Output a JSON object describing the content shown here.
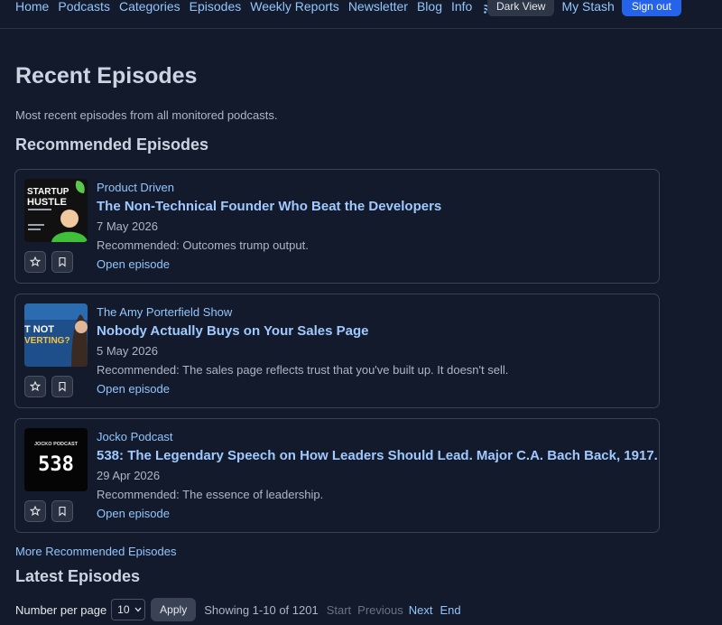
{
  "nav": {
    "items": [
      "Home",
      "Podcasts",
      "Categories",
      "Episodes",
      "Weekly Reports",
      "Newsletter",
      "Blog",
      "Info"
    ],
    "dark_view": "Dark View",
    "my_stash": "My Stash",
    "sign_out": "Sign out"
  },
  "page": {
    "title": "Recent Episodes",
    "subtitle": "Most recent episodes from all monitored podcasts.",
    "recommended_heading": "Recommended Episodes",
    "latest_heading": "Latest Episodes",
    "more_recommended": "More Recommended Episodes"
  },
  "recommended": [
    {
      "podcast": "Product Driven",
      "title": "The Non-Technical Founder Who Beat the Developers",
      "date": "7 May 2026",
      "recommendation": "Recommended: Outcomes trump output.",
      "open": "Open episode",
      "thumb_text": [
        "STARTUP",
        "HUSTLE"
      ]
    },
    {
      "podcast": "The Amy Porterfield Show",
      "title": "Nobody Actually Buys on Your Sales Page",
      "date": "5 May 2026",
      "recommendation": "Recommended: The sales page reflects trust that you've built up. It doesn't sell.",
      "open": "Open episode",
      "thumb_text": [
        "T NOT",
        "VERTING?"
      ]
    },
    {
      "podcast": "Jocko Podcast",
      "title": "538: The Legendary Speech on How Leaders Should Lead. Major C.A. Bach Back, 1917.",
      "date": "29 Apr 2026",
      "recommendation": "Recommended: The essence of leadership.",
      "open": "Open episode",
      "thumb_text": [
        "JOCKO PODCAST",
        "538"
      ]
    }
  ],
  "pager": {
    "label": "Number per page",
    "per_page": "10",
    "apply": "Apply",
    "showing": "Showing 1-10 of 1201",
    "start": "Start",
    "previous": "Previous",
    "next": "Next",
    "end": "End"
  },
  "colors": {
    "background": "#131a2b",
    "accent": "#2563eb",
    "link": "#93c5fd"
  }
}
